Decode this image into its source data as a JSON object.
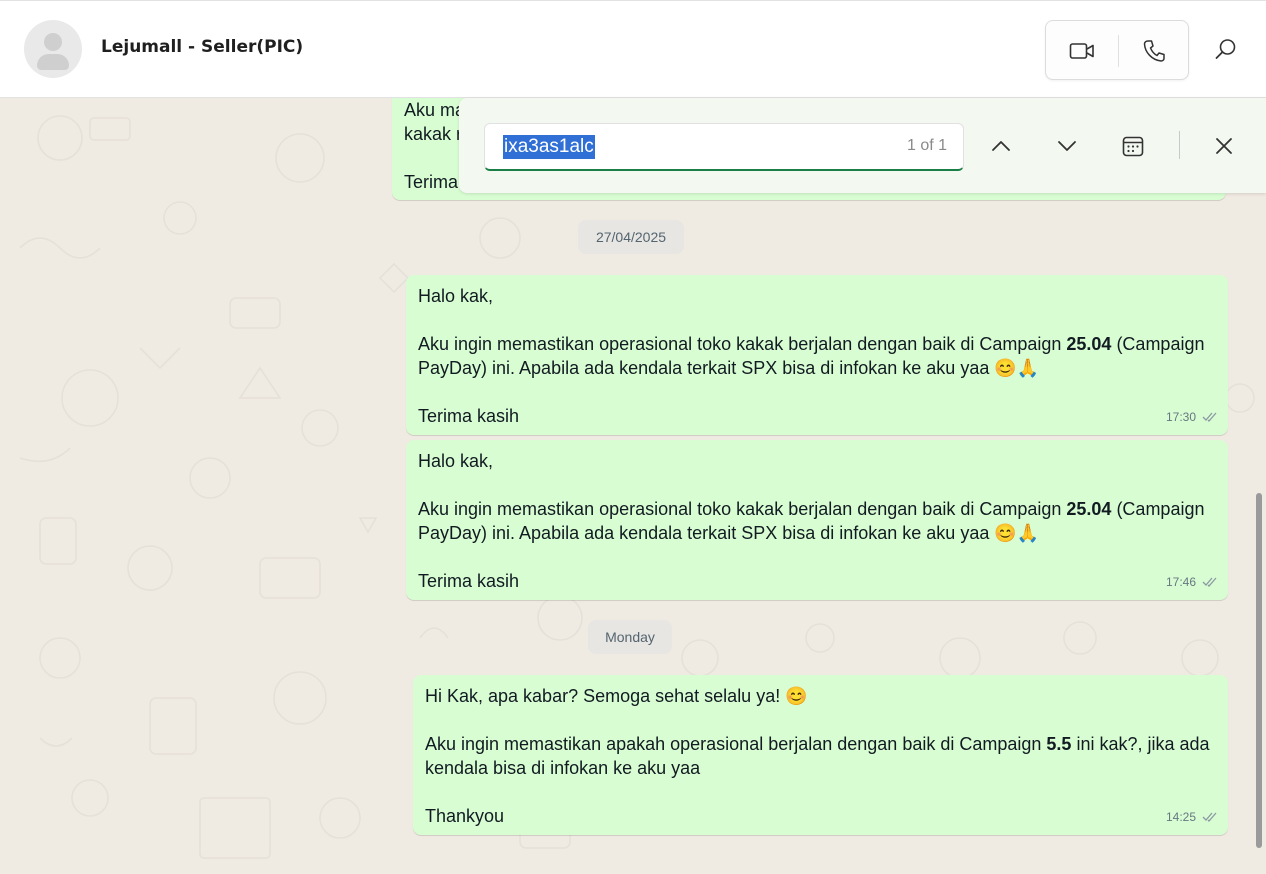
{
  "header": {
    "contact_name": "Lejumall - Seller(PIC)",
    "icons": [
      "avatar-placeholder",
      "video-icon",
      "phone-icon",
      "search-icon"
    ]
  },
  "find_bar": {
    "query": "ixa3as1alc",
    "match_count": "1 of 1",
    "icons": [
      "chevron-up-icon",
      "chevron-down-icon",
      "calendar-icon",
      "close-icon"
    ]
  },
  "messages": [
    {
      "partial_lines": [
        "Aku ma",
        "kakak r",
        "Terima"
      ]
    }
  ],
  "date_separators": [
    "27/04/2025",
    "Monday"
  ],
  "bubbles": [
    {
      "greeting": "Halo kak,",
      "body_1a": "Aku ingin memastikan operasional toko kakak berjalan dengan baik di Campaign ",
      "body_1b": "25.04",
      "body_1c": " (Campaign",
      "body_2": "PayDay) ini. Apabila ada kendala terkait SPX bisa di infokan ke aku yaa 😊🙏",
      "closing": "Terima kasih",
      "time": "17:30"
    },
    {
      "greeting": "Halo kak,",
      "body_1a": "Aku ingin memastikan operasional toko kakak berjalan dengan baik di Campaign ",
      "body_1b": "25.04",
      "body_1c": " (Campaign",
      "body_2": "PayDay) ini. Apabila ada kendala terkait SPX bisa di infokan ke aku yaa 😊🙏",
      "closing": "Terima kasih",
      "time": "17:46"
    },
    {
      "greeting": "Hi Kak, apa kabar? Semoga sehat selalu ya! 😊",
      "body_1a": "Aku ingin memastikan apakah operasional berjalan dengan baik di Campaign ",
      "body_1b": "5.5",
      "body_1c": " ini kak?, jika ada",
      "body_2": "kendala bisa di infokan ke aku yaa",
      "closing": "Thankyou",
      "time": "14:25"
    }
  ],
  "colors": {
    "bubble_out": "#d9fdd3",
    "chat_bg": "#efeae2",
    "accent": "#1a7f46",
    "selection": "#2f6fd6"
  }
}
